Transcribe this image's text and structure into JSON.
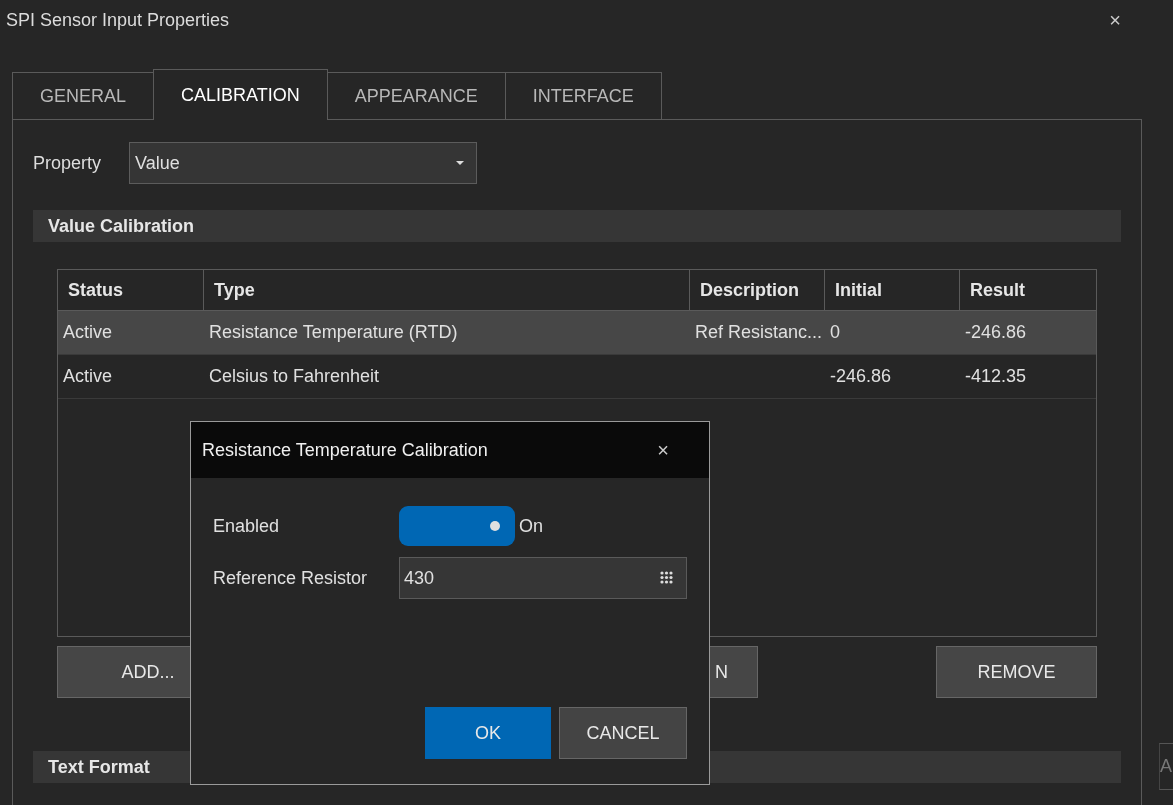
{
  "window": {
    "title": "SPI Sensor Input Properties",
    "close": "×"
  },
  "tabs": [
    {
      "label": "GENERAL",
      "selected": false
    },
    {
      "label": "CALIBRATION",
      "selected": true
    },
    {
      "label": "APPEARANCE",
      "selected": false
    },
    {
      "label": "INTERFACE",
      "selected": false
    }
  ],
  "property": {
    "label": "Property",
    "value": "Value"
  },
  "value_calibration": {
    "title": "Value Calibration",
    "table": {
      "columns": [
        "Status",
        "Type",
        "Description",
        "Initial",
        "Result"
      ],
      "rows": [
        {
          "cells": [
            "Active",
            "Resistance Temperature (RTD)",
            "Ref Resistanc...",
            "0",
            "-246.86"
          ],
          "selected": true
        },
        {
          "cells": [
            "Active",
            "Celsius to Fahrenheit",
            "",
            "-246.86",
            "-412.35"
          ],
          "selected": false
        }
      ]
    },
    "buttons": [
      {
        "label": "ADD...",
        "kind": "left"
      },
      {
        "label": "N",
        "kind": "middle"
      },
      {
        "label": "REMOVE",
        "kind": "right"
      }
    ]
  },
  "text_format": {
    "title": "Text Format"
  },
  "background_fragment": "A",
  "dialog": {
    "title": "Resistance Temperature Calibration",
    "close": "×",
    "enabled": {
      "label": "Enabled",
      "on": true,
      "state_label": "On"
    },
    "reference_resistor": {
      "label": "Reference Resistor",
      "value": "430"
    },
    "buttons": [
      {
        "label": "OK",
        "kind": "primary"
      },
      {
        "label": "CANCEL",
        "kind": "secondary"
      }
    ]
  }
}
